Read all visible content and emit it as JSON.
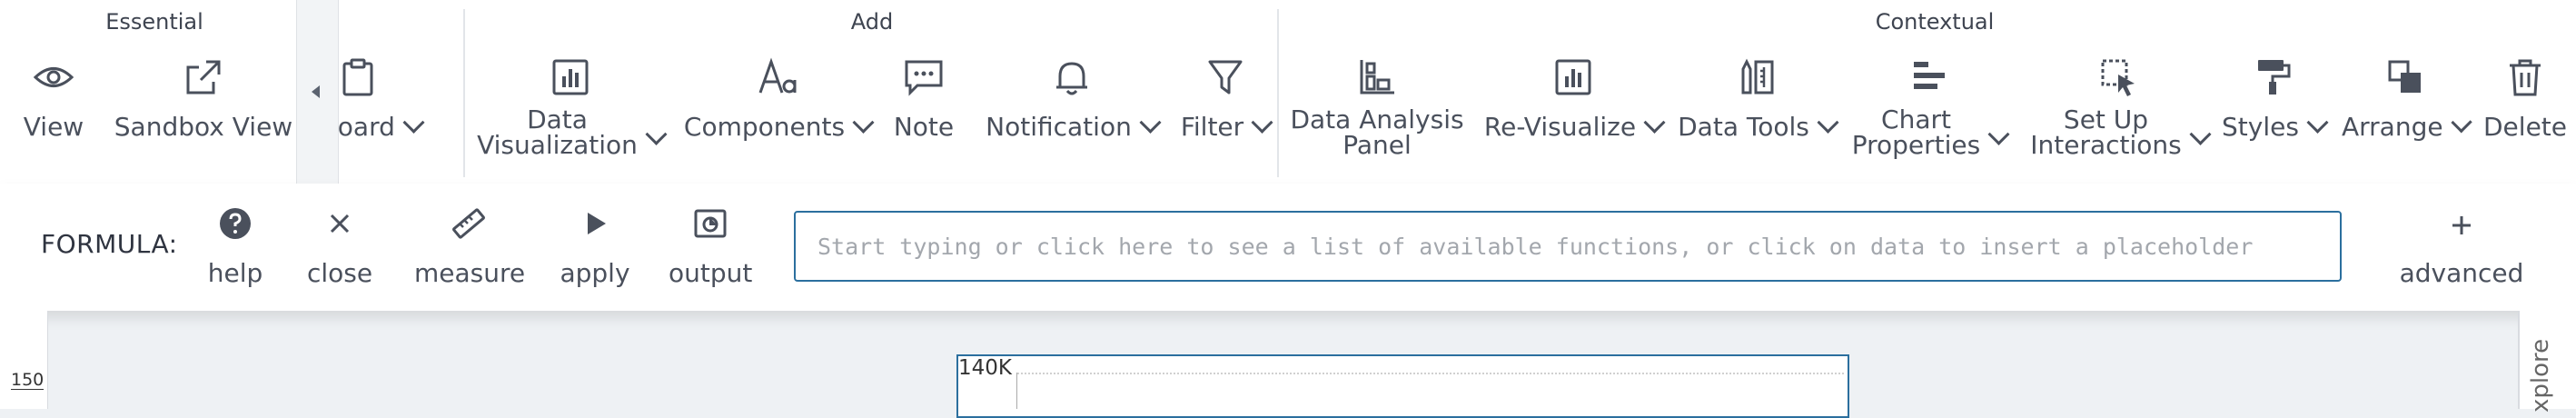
{
  "ribbon": {
    "groups": {
      "essential": "Essential",
      "add": "Add",
      "contextual": "Contextual"
    },
    "essential": {
      "view": "View",
      "sandbox_view": "Sandbox View",
      "dashboard_partial": "board"
    },
    "add": {
      "data_visualization_l1": "Data",
      "data_visualization_l2": "Visualization",
      "components": "Components",
      "note": "Note",
      "notification": "Notification",
      "filter": "Filter"
    },
    "contextual": {
      "data_analysis_panel_l1": "Data Analysis",
      "data_analysis_panel_l2": "Panel",
      "re_visualize": "Re-Visualize",
      "data_tools": "Data Tools",
      "chart_properties_l1": "Chart",
      "chart_properties_l2": "Properties",
      "set_up_interactions_l1": "Set Up",
      "set_up_interactions_l2": "Interactions",
      "styles": "Styles",
      "arrange": "Arrange",
      "delete": "Delete"
    }
  },
  "formula": {
    "label": "FORMULA:",
    "help": "help",
    "close": "close",
    "measure": "measure",
    "apply": "apply",
    "output": "output",
    "input_value": "",
    "input_placeholder": "Start typing or click here to see a list of available functions, or click on data to insert a placeholder",
    "advanced": "advanced"
  },
  "canvas": {
    "ruler_value": "150",
    "chart_tick": "140K",
    "right_rail_label": "xplore"
  },
  "colors": {
    "accent": "#2b6f9e",
    "icon": "#4a505c"
  }
}
